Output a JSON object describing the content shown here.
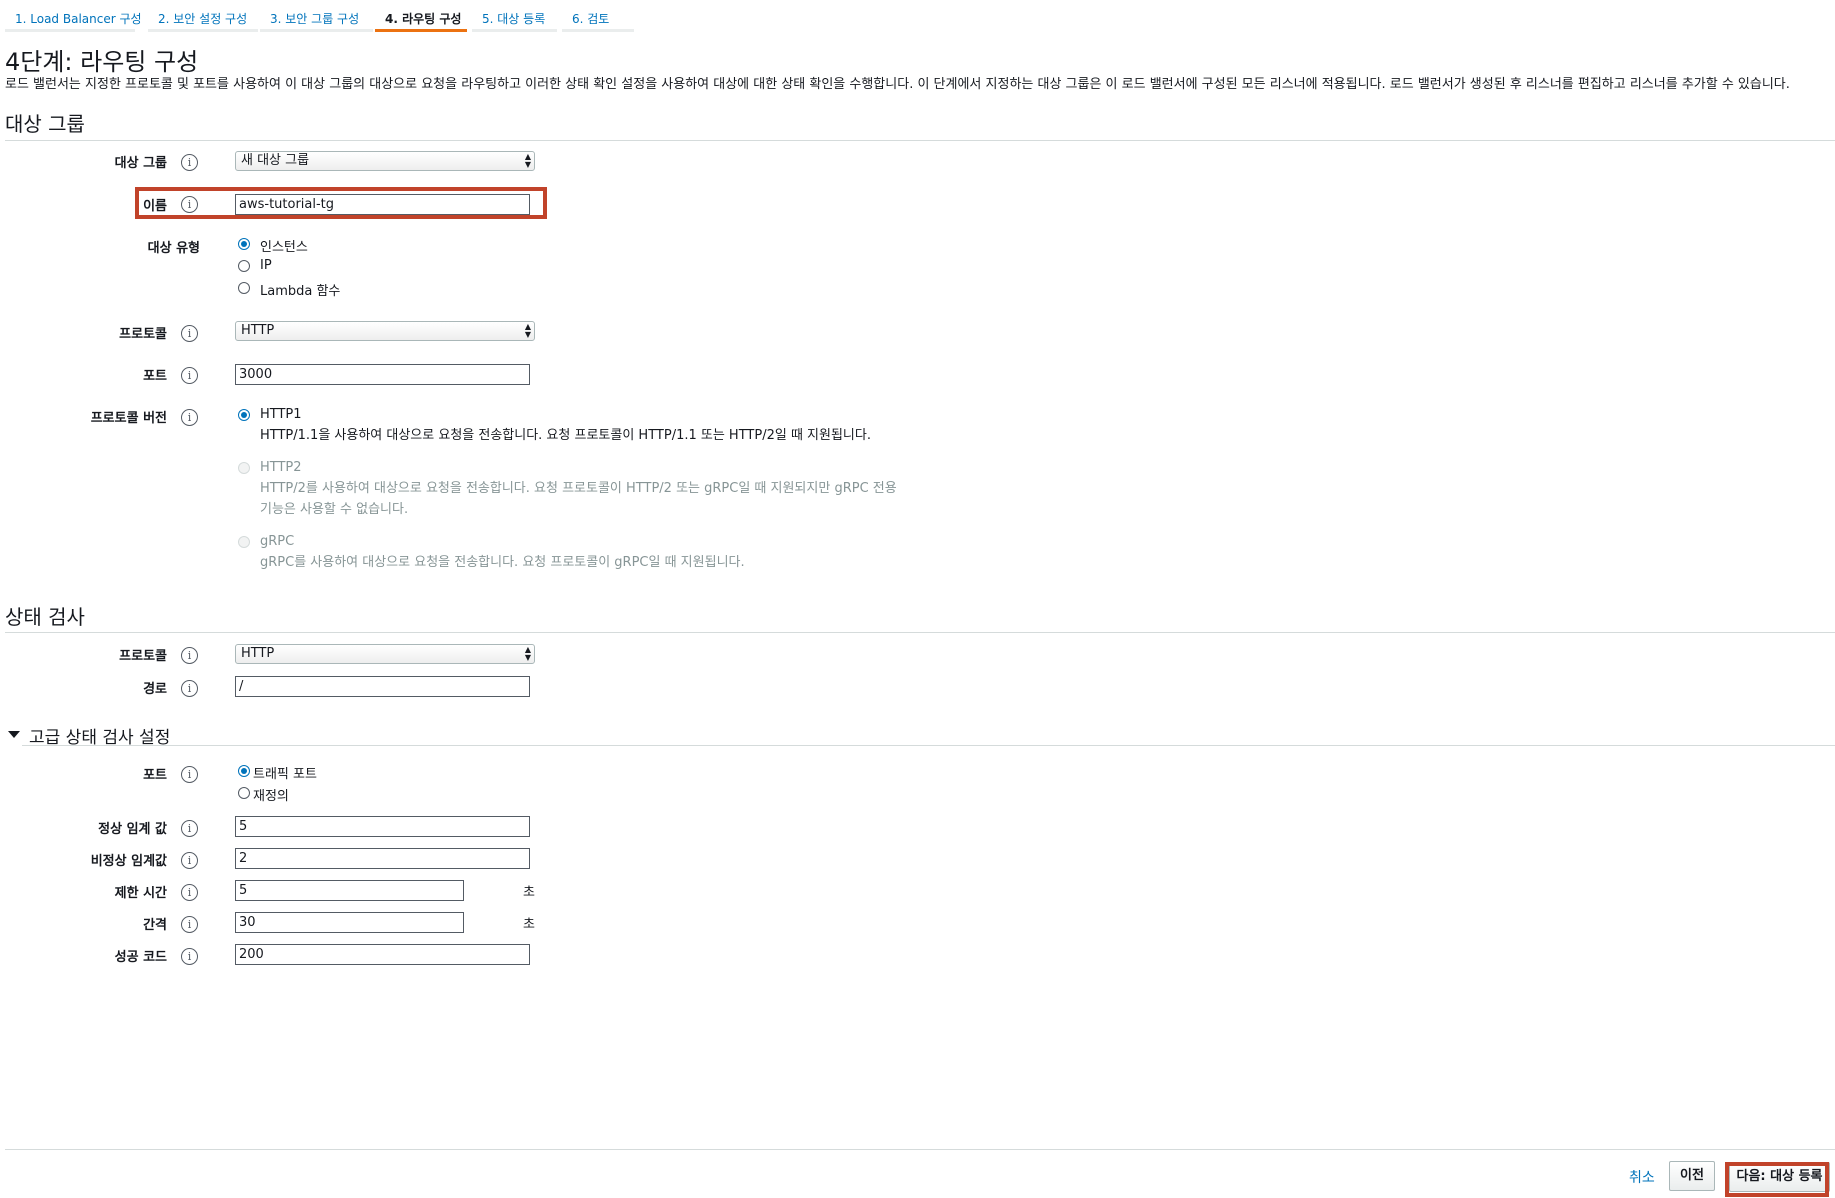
{
  "wizard": {
    "tabs": [
      {
        "label": "1. Load Balancer 구성"
      },
      {
        "label": "2. 보안 설정 구성"
      },
      {
        "label": "3. 보안 그룹 구성"
      },
      {
        "label": "4. 라우팅 구성",
        "active": true
      },
      {
        "label": "5. 대상 등록"
      },
      {
        "label": "6. 검토"
      }
    ]
  },
  "page": {
    "title": "4단계: 라우팅 구성",
    "description": "로드 밸런서는 지정한 프로토콜 및 포트를 사용하여 이 대상 그룹의 대상으로 요청을 라우팅하고 이러한 상태 확인 설정을 사용하여 대상에 대한 상태 확인을 수행합니다. 이 단계에서 지정하는 대상 그룹은 이 로드 밸런서에 구성된 모든 리스너에 적용됩니다. 로드 밸런서가 생성된 후 리스너를 편집하고 리스너를 추가할 수 있습니다."
  },
  "target_group": {
    "section_title": "대상 그룹",
    "group_label": "대상 그룹",
    "group_value": "새 대상 그룹",
    "name_label": "이름",
    "name_value": "aws-tutorial-tg",
    "type_label": "대상 유형",
    "type_options": [
      "인스턴스",
      "IP",
      "Lambda 함수"
    ],
    "type_selected": "인스턴스",
    "protocol_label": "프로토콜",
    "protocol_value": "HTTP",
    "port_label": "포트",
    "port_value": "3000",
    "protocol_version_label": "프로토콜 버전",
    "protocol_versions": [
      {
        "name": "HTTP1",
        "desc": "HTTP/1.1을 사용하여 대상으로 요청을 전송합니다. 요청 프로토콜이 HTTP/1.1 또는 HTTP/2일 때 지원됩니다.",
        "checked": true,
        "disabled": false
      },
      {
        "name": "HTTP2",
        "desc_line1": "HTTP/2를 사용하여 대상으로 요청을 전송합니다. 요청 프로토콜이 HTTP/2 또는 gRPC일 때 지원되지만 gRPC 전용",
        "desc_line2": "기능은 사용할 수 없습니다.",
        "checked": false,
        "disabled": true
      },
      {
        "name": "gRPC",
        "desc": "gRPC를 사용하여 대상으로 요청을 전송합니다. 요청 프로토콜이 gRPC일 때 지원됩니다.",
        "checked": false,
        "disabled": true
      }
    ]
  },
  "health_check": {
    "section_title": "상태 검사",
    "protocol_label": "프로토콜",
    "protocol_value": "HTTP",
    "path_label": "경로",
    "path_value": "/"
  },
  "advanced": {
    "section_title": "고급 상태 검사 설정",
    "port_label": "포트",
    "port_options": [
      "트래픽 포트",
      "재정의"
    ],
    "port_selected": "트래픽 포트",
    "healthy_threshold_label": "정상 임계 값",
    "healthy_threshold_value": "5",
    "unhealthy_threshold_label": "비정상 임계값",
    "unhealthy_threshold_value": "2",
    "timeout_label": "제한 시간",
    "timeout_value": "5",
    "timeout_unit": "초",
    "interval_label": "간격",
    "interval_value": "30",
    "interval_unit": "초",
    "success_codes_label": "성공 코드",
    "success_codes_value": "200"
  },
  "footer": {
    "cancel_label": "취소",
    "previous_label": "이전",
    "next_label": "다음: 대상 등록"
  },
  "colors": {
    "link": "#0073bb",
    "active_tab_underline": "#ec7211",
    "highlight_box": "#c1432a"
  },
  "icons": {
    "info": "info-icon",
    "select_arrows": "select-arrows-icon",
    "collapse": "caret-down-icon"
  }
}
